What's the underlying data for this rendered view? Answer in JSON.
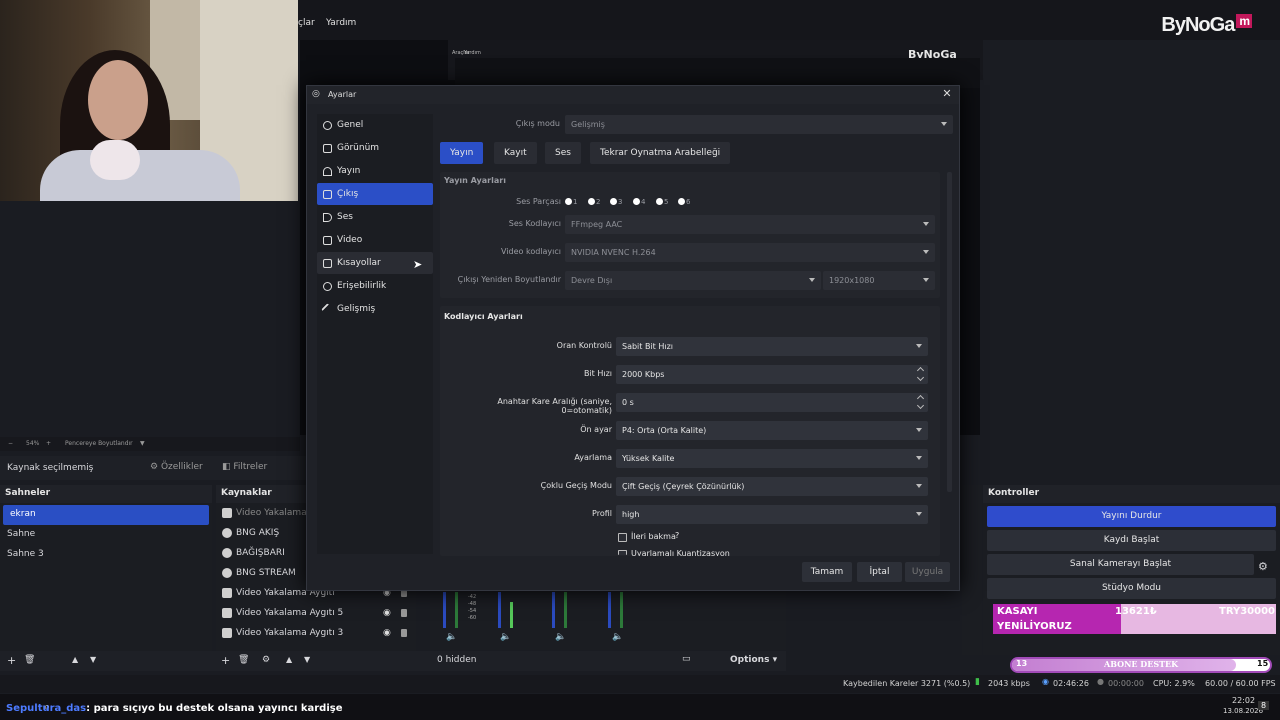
{
  "menu": {
    "tools": "çlar",
    "help": "Yardım"
  },
  "logo": {
    "text": "ByNoGa",
    "mark": "m"
  },
  "nested_menu": {
    "a": "Araçlar",
    "b": "Yardım"
  },
  "preview_toolbar": {
    "zoom": "54%",
    "fit": "Pencereye Boyutlandır"
  },
  "source_bar": {
    "no_selection": "Kaynak seçilmemiş",
    "properties": "Özellikler",
    "filters": "Filtreler"
  },
  "scenes": {
    "title": "Sahneler",
    "items": [
      "ekran",
      "Sahne",
      "Sahne 3"
    ]
  },
  "sources": {
    "title": "Kaynaklar",
    "items": [
      "Video Yakalama A",
      "BNG AKIŞ",
      "BAĞIŞBARI",
      "BNG STREAM",
      "Video Yakalama Aygıtı",
      "Video Yakalama Aygıtı 5",
      "Video Yakalama Aygıtı 3"
    ]
  },
  "mixer": {
    "hidden": "0 hidden",
    "options": "Options",
    "scale": [
      "-42",
      "-48",
      "-54",
      "-60"
    ]
  },
  "controls": {
    "title": "Kontroller",
    "stop_stream": "Yayını Durdur",
    "start_record": "Kaydı Başlat",
    "virtual_cam": "Sanal Kamerayı Başlat",
    "studio": "Stüdyo Modu"
  },
  "overlay": {
    "kasa_top": "KASAYI",
    "kasa_bottom": "YENİLİYORUZ",
    "amount": "13621₺",
    "goal": "TRY30000",
    "abone_left": "13",
    "abone_label": "ABONE DESTEK",
    "abone_right": "15"
  },
  "abone_progress": 0.87,
  "status": {
    "dropped": "Kaybedilen Kareler 3271 (%0.5)",
    "bitrate": "2043 kbps",
    "live_time": "02:46:26",
    "rec_time": "00:00:00",
    "cpu": "CPU: 2.9%",
    "fps": "60.00 / 60.00 FPS"
  },
  "taskbar": {
    "time": "22:02",
    "date": "13.08.2026",
    "notif": "8"
  },
  "chat": {
    "user": "Sepultura_das",
    "message": ": para sıçıyo bu destek olsana yayıncı kardişe"
  },
  "dialog": {
    "title": "Ayarlar",
    "close": "✕",
    "nav": [
      "Genel",
      "Görünüm",
      "Yayın",
      "Çıkış",
      "Ses",
      "Video",
      "Kısayollar",
      "Erişebilirlik",
      "Gelişmiş"
    ],
    "output_mode_label": "Çıkış modu",
    "output_mode": "Gelişmiş",
    "tabs": [
      "Yayın",
      "Kayıt",
      "Ses",
      "Tekrar Oynatma Arabelleği"
    ],
    "stream_section": "Yayın Ayarları",
    "audio_track_label": "Ses Parçası",
    "tracks": [
      "1",
      "2",
      "3",
      "4",
      "5",
      "6"
    ],
    "audio_encoder_label": "Ses Kodlayıcı",
    "audio_encoder": "FFmpeg AAC",
    "video_encoder_label": "Video kodlayıcı",
    "video_encoder": "NVIDIA NVENC H.264",
    "rescale_label": "Çıkışı Yeniden Boyutlandır",
    "rescale": "Devre Dışı",
    "rescale_res": "1920x1080",
    "encoder_section": "Kodlayıcı Ayarları",
    "rate_control_label": "Oran Kontrolü",
    "rate_control": "Sabit Bit Hızı",
    "bitrate_label": "Bit Hızı",
    "bitrate": "2000 Kbps",
    "keyframe_label": "Anahtar Kare Aralığı (saniye, 0=otomatik)",
    "keyframe": "0 s",
    "preset_label": "Ön ayar",
    "preset": "P4: Orta (Orta Kalite)",
    "tuning_label": "Ayarlama",
    "tuning": "Yüksek Kalite",
    "multipass_label": "Çoklu Geçiş Modu",
    "multipass": "Çift Geçiş (Çeyrek Çözünürlük)",
    "profile_label": "Profil",
    "profile": "high",
    "lookahead": "İleri bakma",
    "aq": "Uyarlamalı Kuantizasyon",
    "ok": "Tamam",
    "cancel": "İptal",
    "apply": "Uygula"
  }
}
